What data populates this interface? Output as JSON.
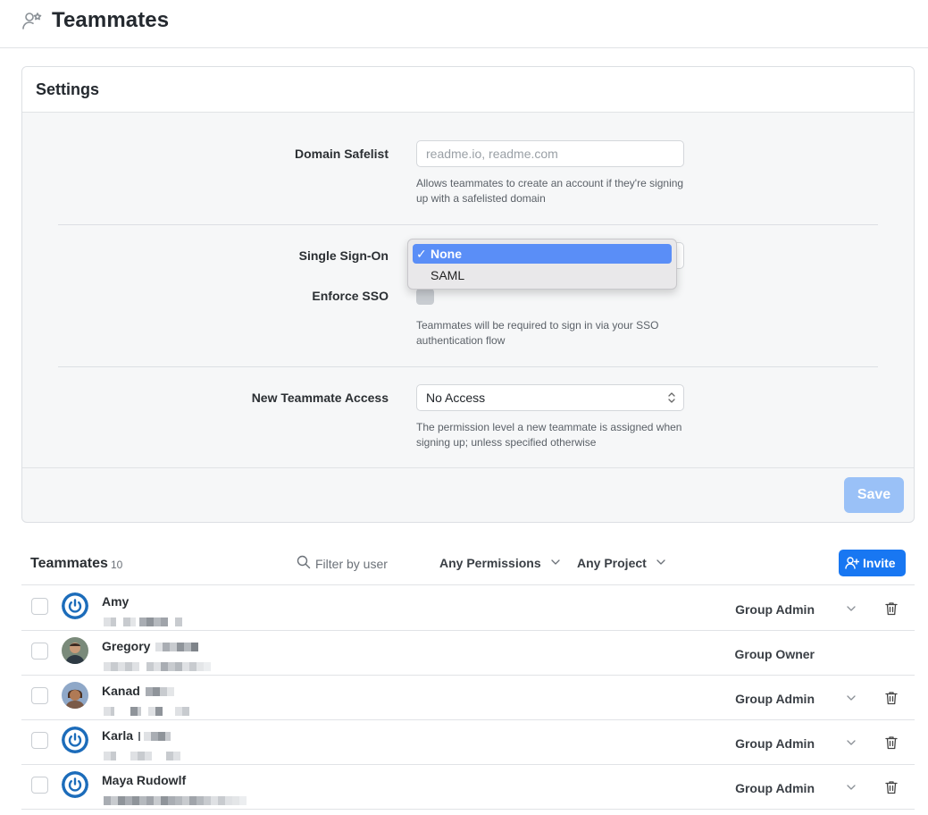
{
  "header": {
    "title": "Teammates",
    "icon": "user-star-icon"
  },
  "settings": {
    "title": "Settings",
    "domain_safelist": {
      "label": "Domain Safelist",
      "placeholder": "readme.io, readme.com",
      "help": "Allows teammates to create an account if they're signing up with a safelisted domain"
    },
    "sso": {
      "label": "Single Sign-On",
      "options": [
        {
          "label": "None",
          "selected": true,
          "check": "✓"
        },
        {
          "label": "SAML",
          "selected": false
        }
      ]
    },
    "enforce_sso": {
      "label": "Enforce SSO",
      "enabled": false,
      "help": "Teammates will be required to sign in via your SSO authentication flow"
    },
    "new_access": {
      "label": "New Teammate Access",
      "value": "No Access",
      "help": "The permission level a new teammate is assigned when signing up; unless specified otherwise"
    },
    "save_label": "Save"
  },
  "teammates": {
    "title": "Teammates",
    "count": "10",
    "filter_placeholder": "Filter by user",
    "permissions_filter": "Any Permissions",
    "project_filter": "Any Project",
    "invite_label": "Invite",
    "rows": [
      {
        "name": "Amy",
        "permission": "Group Admin",
        "avatar": "power-icon",
        "editable": true
      },
      {
        "name": "Gregory",
        "permission": "Group Owner",
        "avatar": "photo",
        "editable": false
      },
      {
        "name": "Kanad",
        "permission": "Group Admin",
        "avatar": "photo",
        "editable": true
      },
      {
        "name": "Karla",
        "permission": "Group Admin",
        "avatar": "power-icon",
        "editable": true
      },
      {
        "name": "Maya Rudowlf",
        "permission": "Group Admin",
        "avatar": "power-icon",
        "editable": true
      }
    ]
  },
  "colors": {
    "accent": "#1877f2",
    "save_disabled": "#9ac1f7",
    "menu_selected": "#5a8ef7"
  }
}
